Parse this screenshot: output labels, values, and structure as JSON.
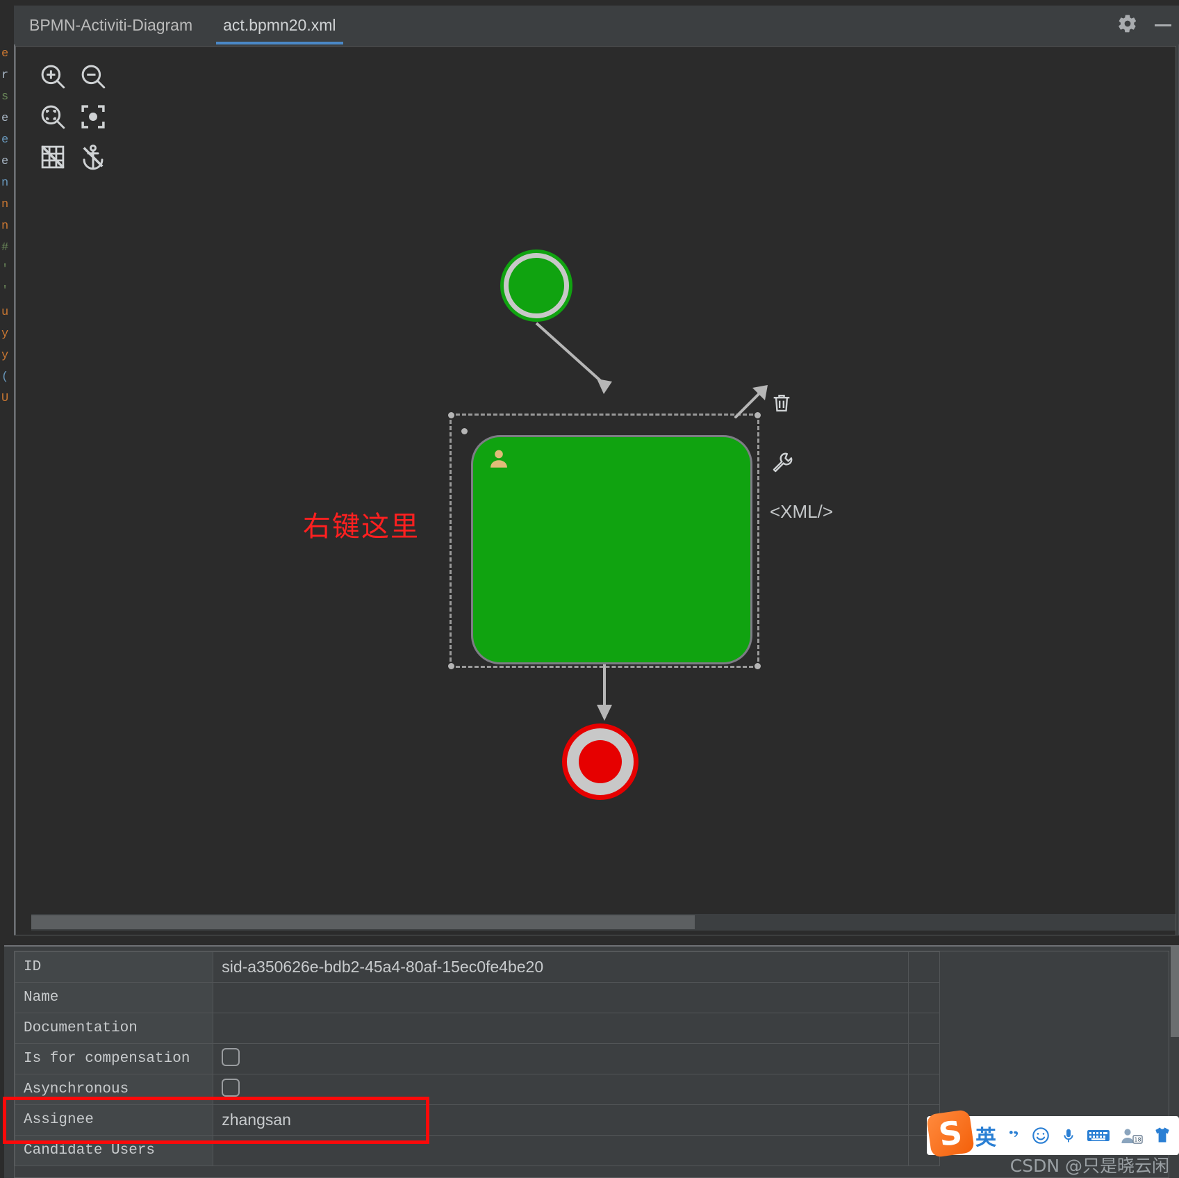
{
  "window": {
    "tabs": [
      {
        "label": "BPMN-Activiti-Diagram",
        "active": false
      },
      {
        "label": "act.bpmn20.xml",
        "active": true
      }
    ],
    "settings_icon": "gear-icon",
    "minimize_icon": "minimize-icon"
  },
  "code_sliver": {
    "lines": [
      "e",
      "r",
      "s",
      "e",
      "e",
      "e",
      "n",
      "n",
      "n",
      "#",
      "",
      "'",
      "'",
      "",
      ""
    ]
  },
  "palette": {
    "tools": [
      {
        "name": "zoom-in-icon",
        "label": "Zoom In"
      },
      {
        "name": "zoom-out-icon",
        "label": "Zoom Out"
      },
      {
        "name": "zoom-fit-icon",
        "label": "Zoom To Fit"
      },
      {
        "name": "zoom-actual-icon",
        "label": "Actual Size"
      },
      {
        "name": "grid-off-icon",
        "label": "Toggle Grid"
      },
      {
        "name": "snap-off-icon",
        "label": "Toggle Snap"
      }
    ]
  },
  "diagram": {
    "annotation": "右键这里",
    "start_event": {
      "name": "start-event",
      "fill": "#10a310",
      "ring": "#c8c8c8"
    },
    "user_task": {
      "name": "user-task",
      "fill": "#10a310",
      "icon": "user-icon",
      "selected": true
    },
    "end_event": {
      "name": "end-event",
      "fill": "#e60000",
      "ring": "#c8c8c8"
    },
    "context_actions": [
      {
        "name": "create-connection-icon",
        "label": ""
      },
      {
        "name": "delete-icon",
        "label": ""
      },
      {
        "name": "configure-icon",
        "label": ""
      },
      {
        "name": "xml-icon",
        "label": "<XML/>"
      }
    ]
  },
  "properties": {
    "rows": [
      {
        "key": "ID",
        "value": "sid-a350626e-bdb2-45a4-80af-15ec0fe4be20",
        "type": "text"
      },
      {
        "key": "Name",
        "value": "",
        "type": "text"
      },
      {
        "key": "Documentation",
        "value": "",
        "type": "text"
      },
      {
        "key": "Is for compensation",
        "value": "",
        "type": "checkbox",
        "checked": false
      },
      {
        "key": "Asynchronous",
        "value": "",
        "type": "checkbox",
        "checked": false
      },
      {
        "key": "Assignee",
        "value": "zhangsan",
        "type": "text",
        "highlighted": true
      },
      {
        "key": "Candidate Users",
        "value": "",
        "type": "text"
      }
    ]
  },
  "ime": {
    "logo": "sogou-logo",
    "items": [
      {
        "name": "ime-language-icon",
        "label": "英"
      },
      {
        "name": "ime-punctuation-icon",
        "label": "，"
      },
      {
        "name": "ime-emoji-icon",
        "label": "☺"
      },
      {
        "name": "ime-voice-icon",
        "label": "🎤"
      },
      {
        "name": "ime-keyboard-icon",
        "label": "⌨"
      },
      {
        "name": "ime-account-icon",
        "label": "18"
      },
      {
        "name": "ime-skin-icon",
        "label": "👕"
      }
    ]
  },
  "watermark": {
    "text": "CSDN @只是晓云闲"
  },
  "colors": {
    "accent": "#4a88c7",
    "task_green": "#10a310",
    "end_red": "#e60000",
    "highlight_red": "#fa0a0a",
    "annotation_red": "#ff2020"
  }
}
